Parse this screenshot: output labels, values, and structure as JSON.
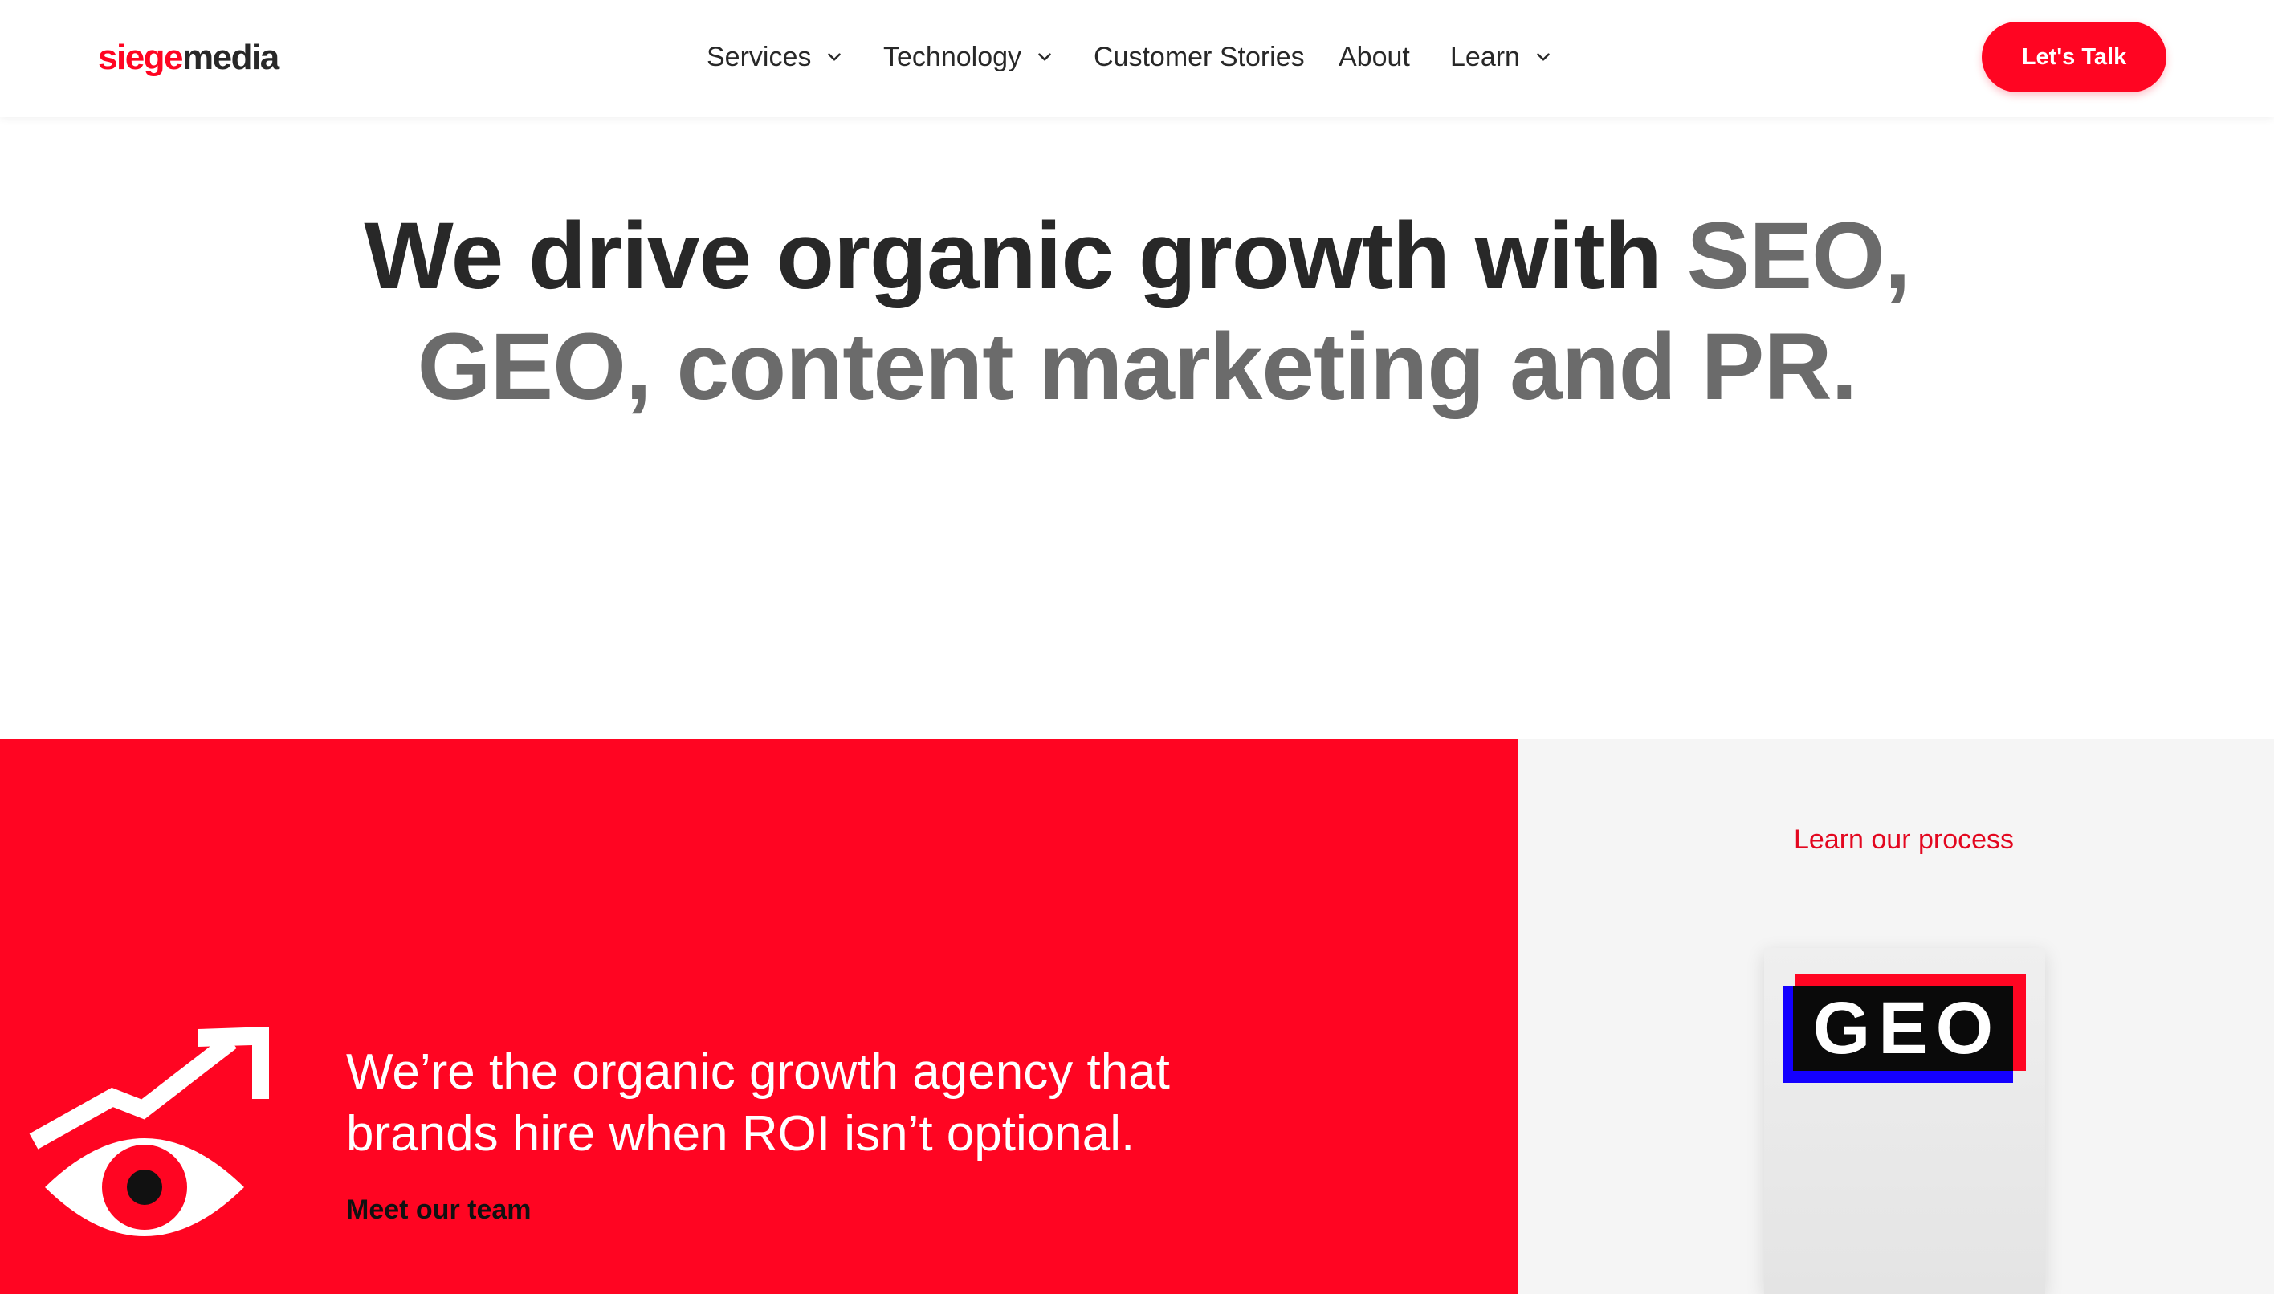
{
  "header": {
    "logo": {
      "part1": "siege",
      "part2": "media"
    },
    "nav": [
      {
        "label": "Services",
        "has_dropdown": true
      },
      {
        "label": "Technology",
        "has_dropdown": true
      },
      {
        "label": "Customer Stories",
        "has_dropdown": false
      },
      {
        "label": "About",
        "has_dropdown": false
      },
      {
        "label": "Learn",
        "has_dropdown": true
      }
    ],
    "cta_label": "Let's Talk"
  },
  "hero": {
    "title_dark": "We drive organic growth with ",
    "title_muted": "SEO, GEO, content marketing and PR."
  },
  "agency": {
    "text": "We’re the organic growth agency that brands hire when ROI isn’t optional.",
    "link": "Meet our team"
  },
  "process": {
    "link": "Learn our process",
    "book_title": "GEO"
  },
  "colors": {
    "brand_red": "#ff0522",
    "text_dark": "#282828",
    "text_muted": "#6b6b6b",
    "panel_grey": "#f5f5f5",
    "accent_blue": "#1400ff"
  }
}
